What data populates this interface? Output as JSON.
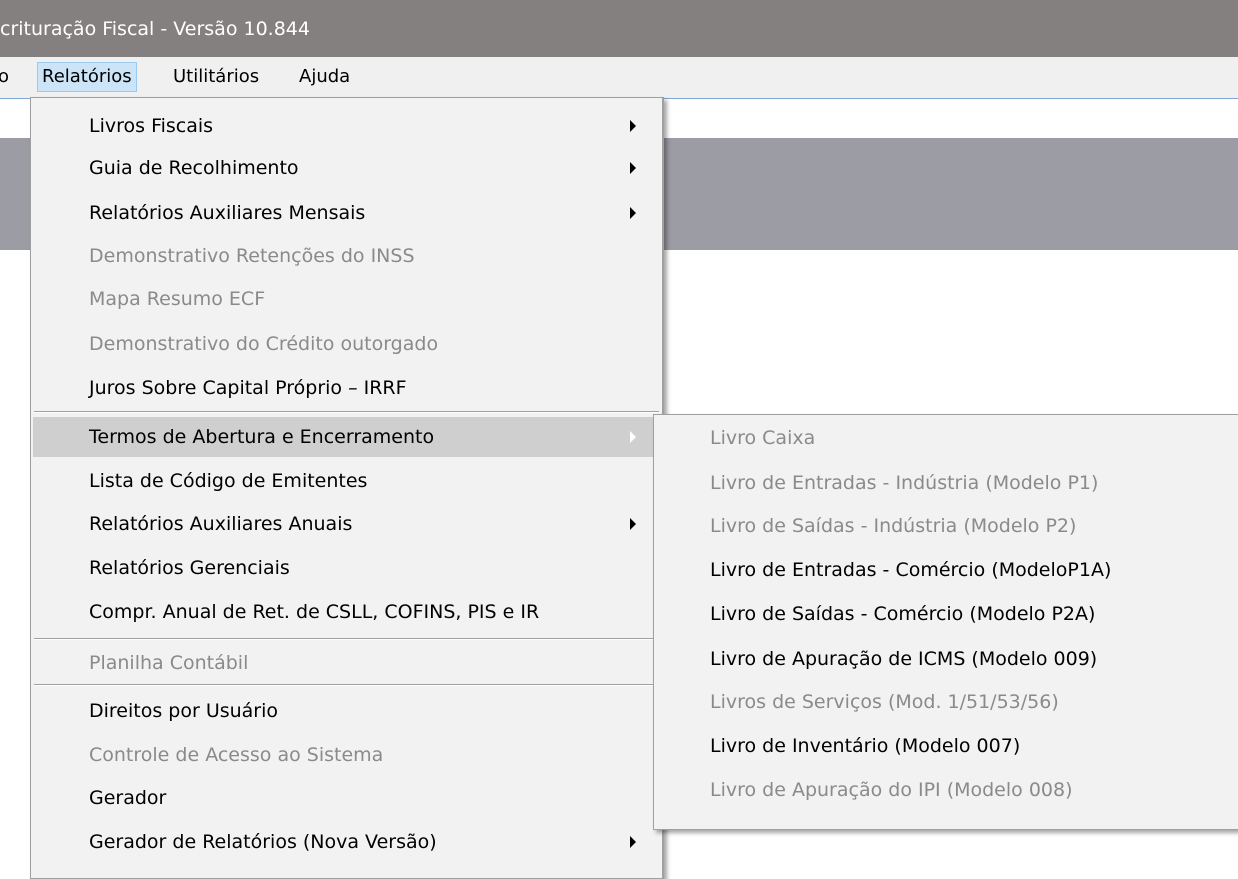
{
  "window": {
    "title": "crituração Fiscal - Versão 10.844"
  },
  "menubar": {
    "items": [
      "o",
      "Relatórios",
      "Utilitários",
      "Ajuda"
    ]
  },
  "relatorios_menu": {
    "items": [
      {
        "label": "Livros Fiscais",
        "submenu": true,
        "disabled": false
      },
      {
        "label": "Guia de Recolhimento",
        "submenu": true,
        "disabled": false
      },
      {
        "label": "Relatórios Auxiliares Mensais",
        "submenu": true,
        "disabled": false
      },
      {
        "label": "Demonstrativo Retenções do INSS",
        "submenu": false,
        "disabled": true
      },
      {
        "label": "Mapa Resumo ECF",
        "submenu": false,
        "disabled": true
      },
      {
        "label": "Demonstrativo do Crédito outorgado",
        "submenu": false,
        "disabled": true
      },
      {
        "label": "Juros Sobre Capital Próprio – IRRF",
        "submenu": false,
        "disabled": false
      },
      {
        "label": "Termos de Abertura e Encerramento",
        "submenu": true,
        "disabled": false,
        "highlighted": true
      },
      {
        "label": "Lista de Código de Emitentes",
        "submenu": false,
        "disabled": false
      },
      {
        "label": "Relatórios Auxiliares Anuais",
        "submenu": true,
        "disabled": false
      },
      {
        "label": "Relatórios Gerenciais",
        "submenu": false,
        "disabled": false
      },
      {
        "label": "Compr. Anual de Ret. de CSLL, COFINS,  PIS e IR",
        "submenu": false,
        "disabled": false
      },
      {
        "label": "Planilha Contábil",
        "submenu": false,
        "disabled": true
      },
      {
        "label": "Direitos por Usuário",
        "submenu": false,
        "disabled": false
      },
      {
        "label": "Controle de Acesso ao Sistema",
        "submenu": false,
        "disabled": true
      },
      {
        "label": "Gerador",
        "submenu": false,
        "disabled": false
      },
      {
        "label": "Gerador de Relatórios (Nova Versão)",
        "submenu": true,
        "disabled": false
      }
    ]
  },
  "termos_submenu": {
    "items": [
      {
        "label": "Livro Caixa",
        "disabled": true
      },
      {
        "label": "Livro de Entradas - Indústria (Modelo P1)",
        "disabled": true
      },
      {
        "label": "Livro de Saídas - Indústria (Modelo P2)",
        "disabled": true
      },
      {
        "label": "Livro de Entradas - Comércio (ModeloP1A)",
        "disabled": false
      },
      {
        "label": "Livro de Saídas - Comércio (Modelo P2A)",
        "disabled": false
      },
      {
        "label": "Livro de Apuração de ICMS (Modelo 009)",
        "disabled": false
      },
      {
        "label": "Livros de Serviços (Mod. 1/51/53/56)",
        "disabled": true
      },
      {
        "label": "Livro de Inventário (Modelo 007)",
        "disabled": false
      },
      {
        "label": "Livro de Apuração do IPI (Modelo 008)",
        "disabled": true
      }
    ]
  },
  "colors": {
    "titlebar": "#848080",
    "menu_bg": "#f2f2f2",
    "highlight": "#cfcfcf",
    "disabled_text": "#8a8a8a",
    "active_menubar": "#cce4f7"
  }
}
